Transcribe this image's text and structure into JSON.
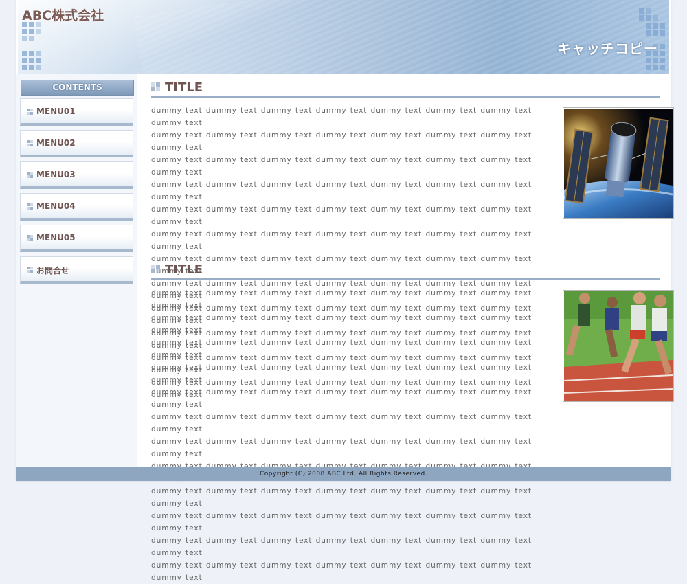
{
  "header": {
    "company": "ABC株式会社",
    "catch_copy": "キャッチコピー"
  },
  "sidebar": {
    "heading": "CONTENTS",
    "items": [
      {
        "label": "MENU01"
      },
      {
        "label": "MENU02"
      },
      {
        "label": "MENU03"
      },
      {
        "label": "MENU04"
      },
      {
        "label": "MENU05"
      },
      {
        "label": "お問合せ"
      }
    ]
  },
  "sections": [
    {
      "title": "TITLE",
      "lines": [
        "dummy text dummy text dummy text dummy text dummy text dummy text dummy text dummy text",
        "dummy text dummy text dummy text dummy text dummy text dummy text dummy text dummy text",
        "dummy text dummy text dummy text dummy text dummy text dummy text dummy text dummy text",
        "dummy text dummy text dummy text dummy text dummy text dummy text dummy text dummy text",
        "dummy text dummy text dummy text dummy text dummy text dummy text dummy text dummy text",
        "dummy text dummy text dummy text dummy text dummy text dummy text dummy text dummy text",
        "dummy text dummy text dummy text dummy text dummy text dummy text dummy text dummy text",
        "dummy text dummy text dummy text dummy text dummy text dummy text dummy text dummy text",
        "dummy text dummy text dummy text dummy text dummy text dummy text dummy text dummy text",
        "dummy text dummy text dummy text dummy text dummy text dummy text dummy text dummy text",
        "dummy text dummy text dummy text dummy text dummy text dummy text dummy text dummy text",
        "dummy text dummy text dummy text dummy text dummy text dummy text dummy text dummy text"
      ],
      "image": "space-telescope-photo"
    },
    {
      "title": "TITLE",
      "lines": [
        "dummy text dummy text dummy text dummy text dummy text dummy text dummy text dummy text",
        "dummy text dummy text dummy text dummy text dummy text dummy text dummy text dummy text",
        "dummy text dummy text dummy text dummy text dummy text dummy text dummy text dummy text",
        "dummy text dummy text dummy text dummy text dummy text dummy text dummy text dummy text",
        "dummy text dummy text dummy text dummy text dummy text dummy text dummy text dummy text",
        "dummy text dummy text dummy text dummy text dummy text dummy text dummy text dummy text",
        "dummy text dummy text dummy text dummy text dummy text dummy text dummy text dummy text",
        "dummy text dummy text dummy text dummy text dummy text dummy text dummy text dummy text",
        "dummy text dummy text dummy text dummy text dummy text dummy text dummy text dummy text",
        "dummy text dummy text dummy text dummy text dummy text dummy text dummy text dummy text",
        "dummy text dummy text dummy text dummy text dummy text dummy text dummy text dummy text",
        "dummy text dummy text dummy text dummy text dummy text dummy text dummy text dummy text"
      ],
      "image": "sprinters-photo"
    }
  ],
  "footer": {
    "copyright": "Copyright (C) 2008 ABC Ltd. All Rights Reserved."
  },
  "colors": {
    "accent": "#8fa6c0",
    "title_text": "#6e5552",
    "header_blue": "#a9c1dc"
  }
}
